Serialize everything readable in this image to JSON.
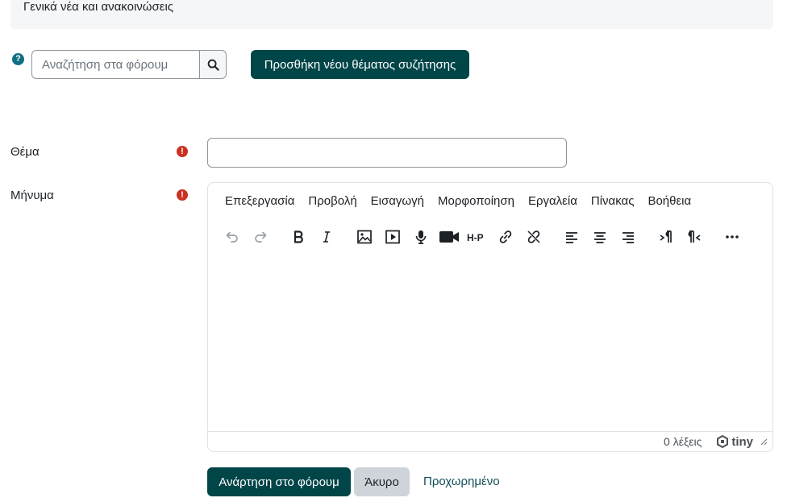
{
  "banner": {
    "text": "Γενικά νέα και ανακοινώσεις"
  },
  "search": {
    "help_icon": "question-circle-icon",
    "placeholder": "Αναζήτηση στα φόρουμ",
    "value": "",
    "button_icon": "search-icon"
  },
  "add_topic": {
    "label": "Προσθήκη νέου θέματος συζήτησης"
  },
  "form": {
    "subject_label": "Θέμα",
    "subject_value": "",
    "message_label": "Μήνυμα",
    "required_icon": "exclamation-circle-icon"
  },
  "editor": {
    "menu": [
      "Επεξεργασία",
      "Προβολή",
      "Εισαγωγή",
      "Μορφοποίηση",
      "Εργαλεία",
      "Πίνακας",
      "Βοήθεια"
    ],
    "toolbar": [
      "undo-icon",
      "redo-icon",
      "bold-icon",
      "italic-icon",
      "image-icon",
      "media-icon",
      "microphone-icon",
      "video-camera-icon",
      "h5p-icon",
      "link-icon",
      "unlink-icon",
      "align-left-icon",
      "align-center-icon",
      "align-right-icon",
      "ltr-icon",
      "rtl-icon",
      "more-icon"
    ],
    "word_count": "0 λέξεις",
    "brand": "tiny"
  },
  "actions": {
    "post_label": "Ανάρτηση στο φόρουμ",
    "cancel_label": "Άκυρο",
    "advanced_label": "Προχωρημένο"
  },
  "colors": {
    "primary": "#004548",
    "required": "#ca3120",
    "help": "#0f6e81",
    "secondary": "#ced4da"
  }
}
